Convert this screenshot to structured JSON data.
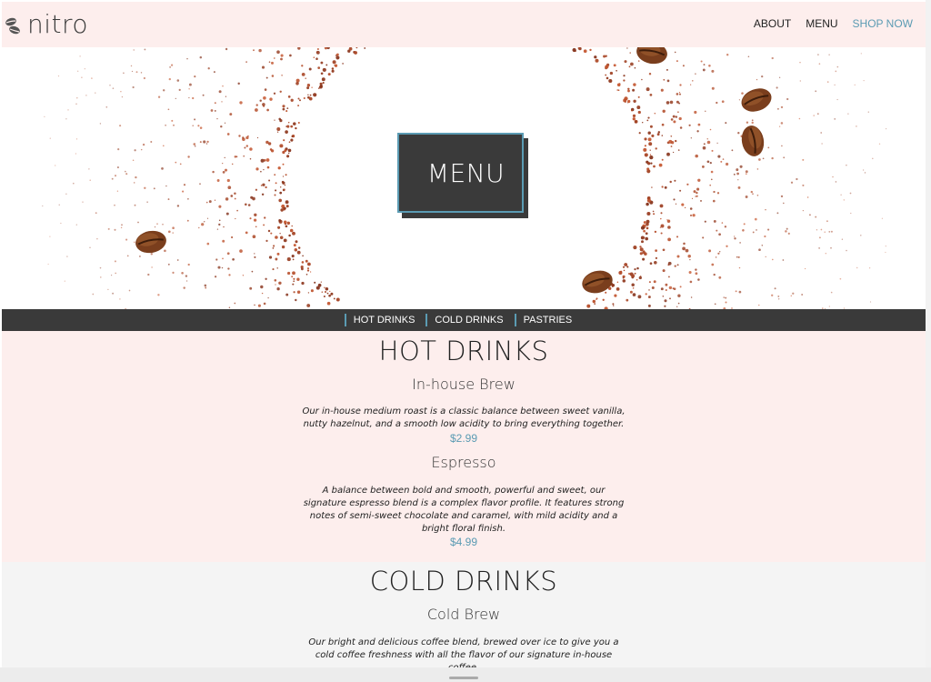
{
  "header": {
    "logo_text": "nitro",
    "nav": [
      {
        "label": "ABOUT"
      },
      {
        "label": "MENU"
      },
      {
        "label": "SHOP NOW"
      }
    ]
  },
  "hero": {
    "title": "MENU"
  },
  "subnav": [
    {
      "label": "HOT DRINKS"
    },
    {
      "label": "COLD DRINKS"
    },
    {
      "label": "PASTRIES"
    }
  ],
  "hot": {
    "title": "HOT DRINKS",
    "items": [
      {
        "name": "In-house Brew",
        "desc": "Our in-house medium roast is a classic balance between sweet vanilla, nutty hazelnut, and a smooth low acidity to bring everything together.",
        "price": "$2.99"
      },
      {
        "name": "Espresso",
        "desc": "A balance between bold and smooth, powerful and sweet, our signature espresso blend is a complex flavor profile. It features strong notes of semi-sweet chocolate and caramel, with mild acidity and a bright floral finish.",
        "price": "$4.99"
      }
    ]
  },
  "cold": {
    "title": "COLD DRINKS",
    "items": [
      {
        "name": "Cold Brew",
        "desc": "Our bright and delicious coffee blend, brewed over ice to give you a cold coffee freshness with all the flavor of our signature in-house coffee."
      }
    ]
  },
  "colors": {
    "accent": "#5b9bb3",
    "dark": "#3a3a3a",
    "pink_bg": "#fdeeed"
  }
}
